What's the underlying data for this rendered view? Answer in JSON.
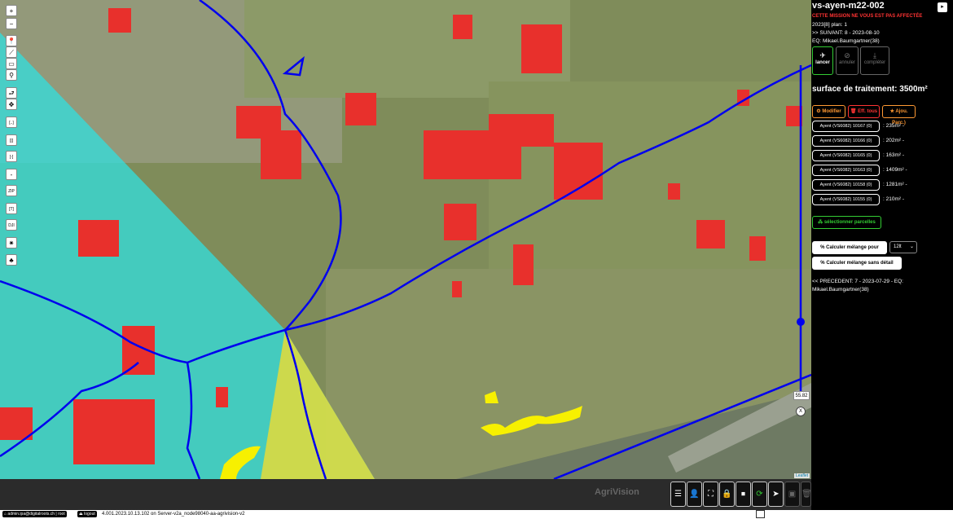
{
  "map": {
    "zoom_in": "+",
    "zoom_out": "−",
    "tools": [
      "📍",
      "⟋",
      "▭",
      "⚲",
      "⮐",
      "✥",
      "[..]",
      "[|]",
      "[◦]",
      "-",
      "ZIP",
      "[T]",
      "DJI",
      "✷",
      "♣"
    ],
    "scale_value": "55.82",
    "scale_close": "X",
    "attribution": "Leaflet"
  },
  "panel": {
    "title": "vs-ayen-m22-002",
    "warning": "CETTE MISSION NE VOUS EST PAS AFFECTÉE",
    "meta_line1": "2023[8] plan: 1",
    "meta_line2": ">> SUIVANT: 8 - 2023-08-10",
    "meta_line3": "EQ: Mikael.Baumgartner(38)",
    "btn_lancer": "lancer",
    "btn_annuler": "annuler",
    "btn_completer": "compléter",
    "surface": "surface de traitement: 3500m²",
    "btn_modifier": "Modifier",
    "btn_eff_tous": "Eff. tous",
    "btn_ajou_parc": "Ajou. Parc.)",
    "parcels": [
      {
        "label": "Ayent (VS6082) 10167 (0)",
        "area": ": 235m² -"
      },
      {
        "label": "Ayent (VS6082) 10166 (0)",
        "area": ": 202m² -"
      },
      {
        "label": "Ayent (VS6082) 10165 (0)",
        "area": ": 163m² -"
      },
      {
        "label": "Ayent (VS6082) 10163 (0)",
        "area": ": 1409m² -"
      },
      {
        "label": "Ayent (VS6082) 10158 (0)",
        "area": ": 1281m² -"
      },
      {
        "label": "Ayent (VS6082) 10155 (0)",
        "area": ": 210m² -"
      }
    ],
    "btn_select_parcels": "sélectionner parcelles",
    "btn_calc_melange": "Calculer mélange pour",
    "calc_select_value": "12lt",
    "btn_calc_sans_detail": "Calculer mélange sans détail",
    "previous_line1": "<< PRECEDENT: 7 - 2023-07-29 - EQ:",
    "previous_line2": "Mikael.Baumgartner(38)",
    "corner_toggle": "▸"
  },
  "bottombar": {
    "logo": "AgriVision"
  },
  "statusbar": {
    "user": "admin.ipa@digitalroots.ch | root",
    "logout": "logout",
    "version": "4.001.2023.10.13.102 on Server-v2a_node98040-aa-agrivision-v2"
  },
  "colors": {
    "accent_green": "#33cc33",
    "accent_red": "#ff3333",
    "accent_orange": "#ff9933",
    "route_blue": "#0000ee",
    "zone_cyan": "#30e0e0",
    "zone_yellow": "#f0dc30"
  }
}
